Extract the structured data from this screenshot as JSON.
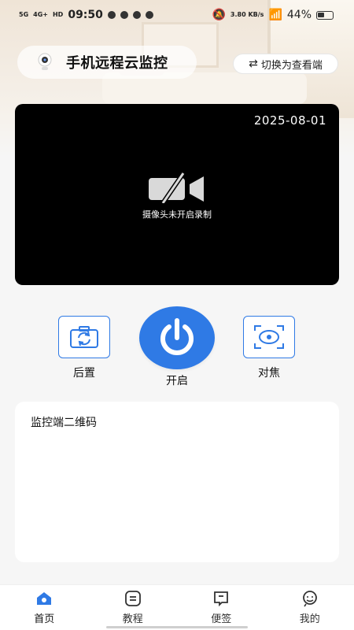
{
  "status_bar": {
    "network1": "5G",
    "network2": "4G+",
    "hd": "HD",
    "time": "09:50",
    "speed": "3.80 KB/s",
    "battery": "44%"
  },
  "header": {
    "title": "手机远程云监控",
    "switch_label": "切换为查看端",
    "icons": {
      "camera": "security-camera-icon",
      "swap": "swap-icon"
    }
  },
  "preview": {
    "date": "2025-08-01",
    "message": "摄像头未开启录制",
    "icon": "camera-off-icon"
  },
  "controls": {
    "rear_label": "后置",
    "power_label": "开启",
    "focus_label": "对焦",
    "accent": "#2f7ae5"
  },
  "qr_card": {
    "title": "监控端二维码"
  },
  "nav": {
    "items": [
      {
        "label": "首页",
        "icon": "home-icon",
        "active": true
      },
      {
        "label": "教程",
        "icon": "tutorial-icon",
        "active": false
      },
      {
        "label": "便签",
        "icon": "note-icon",
        "active": false
      },
      {
        "label": "我的",
        "icon": "profile-icon",
        "active": false
      }
    ]
  }
}
